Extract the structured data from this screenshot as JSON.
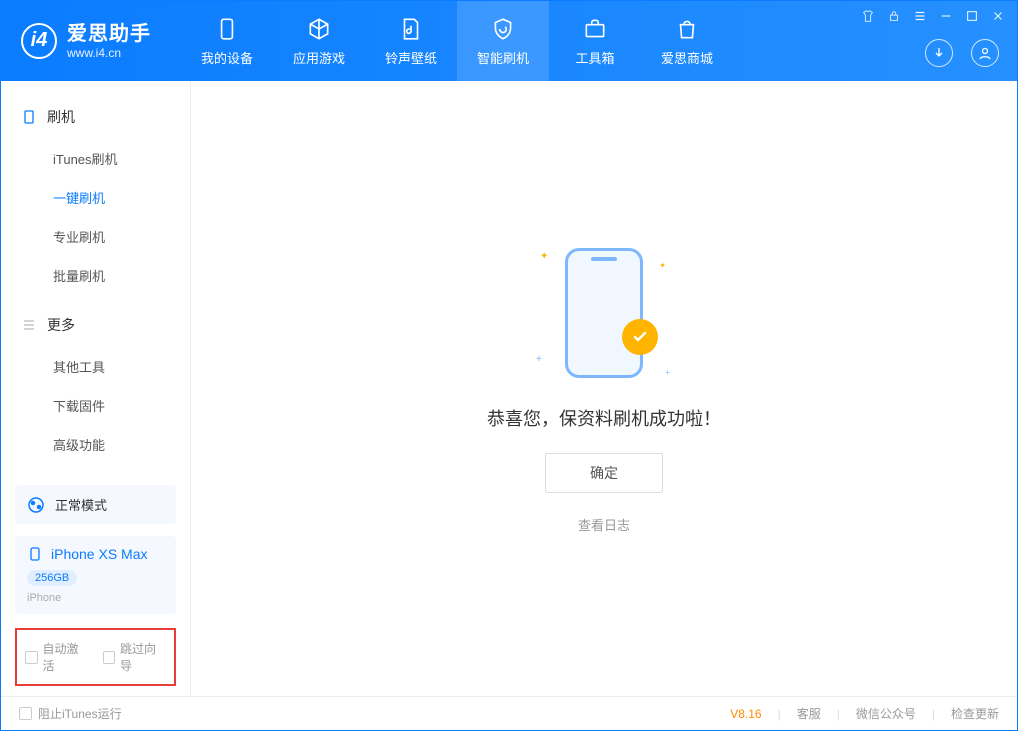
{
  "app": {
    "title": "爱思助手",
    "url": "www.i4.cn"
  },
  "nav": {
    "my_device": "我的设备",
    "apps_games": "应用游戏",
    "ringtone_wallpaper": "铃声壁纸",
    "smart_flash": "智能刷机",
    "toolbox": "工具箱",
    "store": "爱思商城"
  },
  "sidebar": {
    "section_flash": "刷机",
    "items_flash": {
      "itunes_flash": "iTunes刷机",
      "one_click_flash": "一键刷机",
      "pro_flash": "专业刷机",
      "batch_flash": "批量刷机"
    },
    "section_more": "更多",
    "items_more": {
      "other_tools": "其他工具",
      "download_firmware": "下载固件",
      "advanced": "高级功能"
    },
    "mode": "正常模式",
    "device": {
      "name": "iPhone XS Max",
      "capacity": "256GB",
      "type": "iPhone"
    },
    "check_auto_activate": "自动激活",
    "check_skip_guide": "跳过向导"
  },
  "main": {
    "success_text": "恭喜您，保资料刷机成功啦！",
    "ok_button": "确定",
    "view_log": "查看日志"
  },
  "footer": {
    "block_itunes": "阻止iTunes运行",
    "version": "V8.16",
    "customer_service": "客服",
    "wechat": "微信公众号",
    "check_update": "检查更新"
  }
}
